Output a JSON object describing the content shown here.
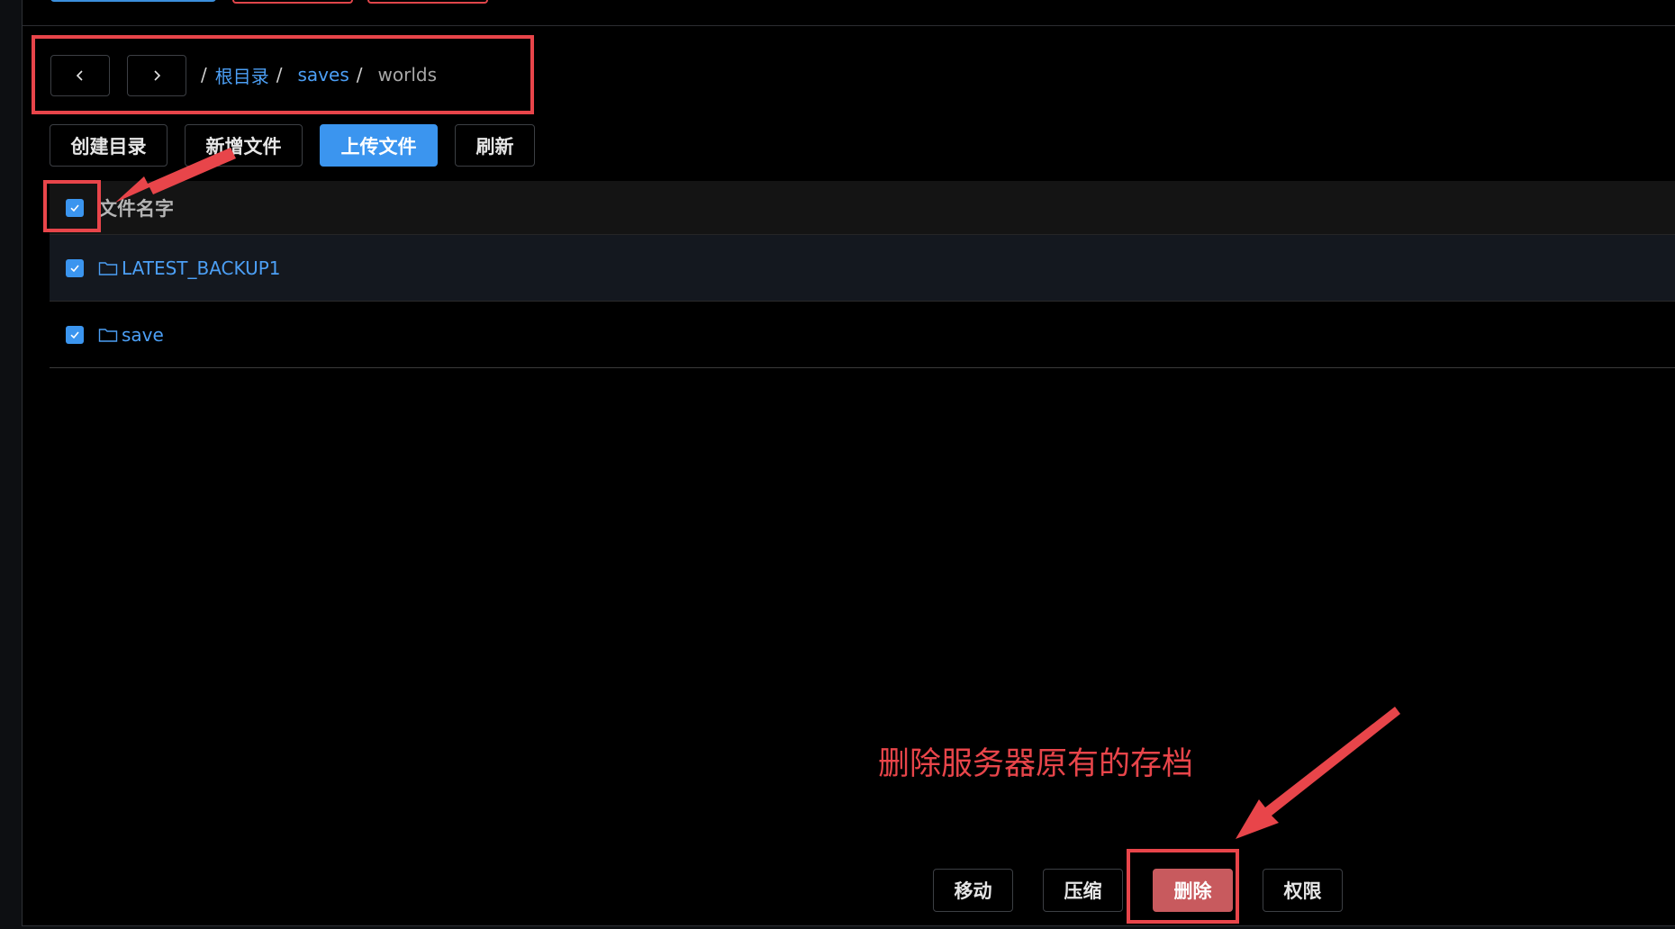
{
  "navigation": {
    "back_icon": "chevron-left-icon",
    "forward_icon": "chevron-right-icon"
  },
  "breadcrumb": {
    "separator": "/",
    "items": [
      {
        "label": "根目录",
        "link": true
      },
      {
        "label": "saves",
        "link": true
      },
      {
        "label": "worlds",
        "link": false
      }
    ]
  },
  "toolbar": {
    "create_dir": "创建目录",
    "new_file": "新增文件",
    "upload_file": "上传文件",
    "refresh": "刷新"
  },
  "table": {
    "header": "文件名字",
    "header_checked": true,
    "rows": [
      {
        "name": "LATEST_BACKUP1",
        "type": "folder",
        "checked": true
      },
      {
        "name": "save",
        "type": "folder",
        "checked": true
      }
    ]
  },
  "actions": {
    "move": "移动",
    "compress": "压缩",
    "delete": "删除",
    "permission": "权限"
  },
  "annotation": {
    "text": "删除服务器原有的存档"
  },
  "colors": {
    "accent": "#3b95ef",
    "link": "#4c9ff5",
    "danger": "#c85a5e",
    "highlight": "#e8454a",
    "background": "#000000"
  }
}
